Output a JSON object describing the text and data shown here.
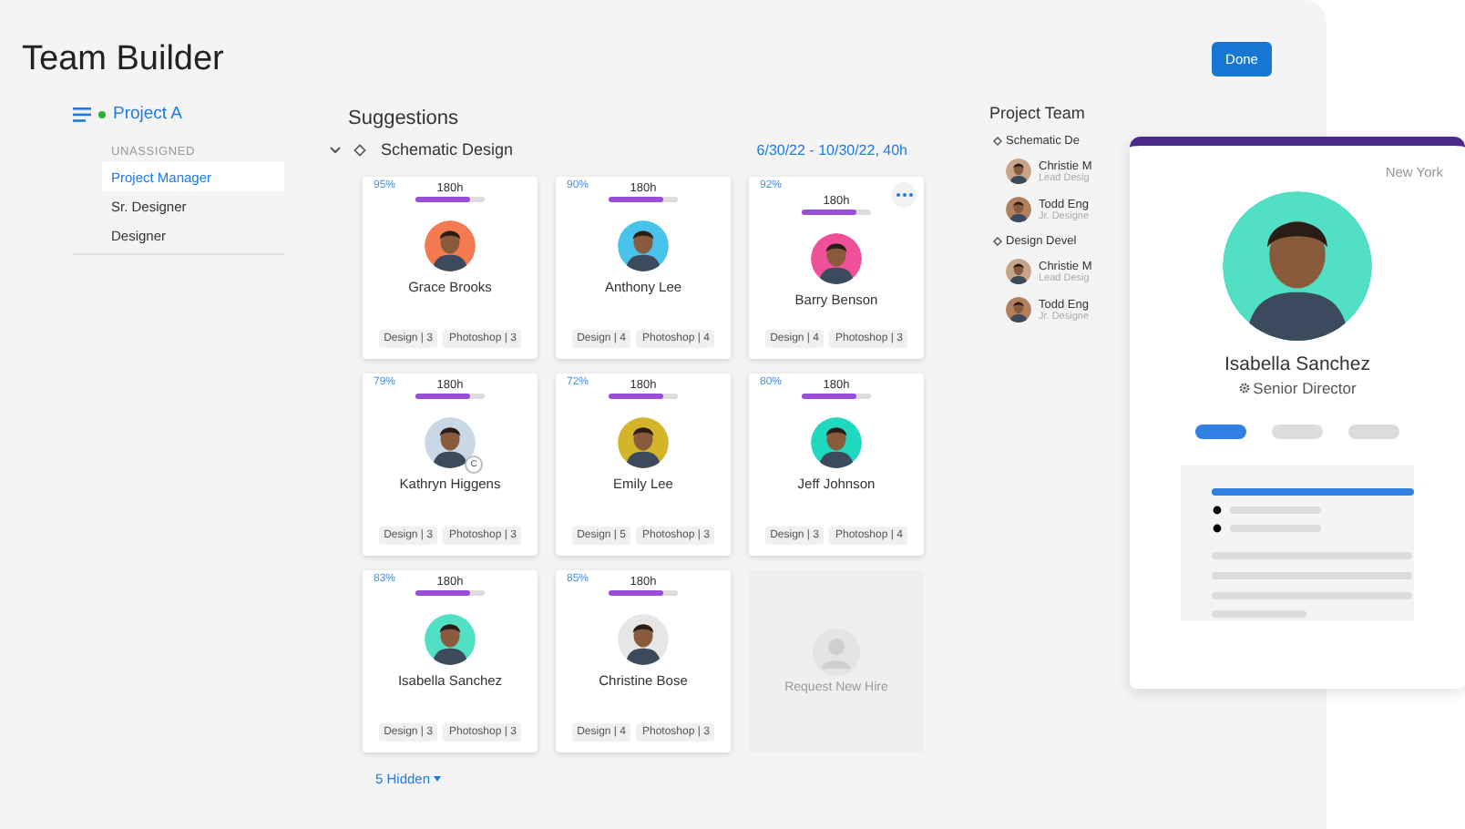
{
  "header": {
    "title": "Team Builder",
    "done_button": "Done"
  },
  "sidebar": {
    "project": "Project A",
    "section_label": "UNASSIGNED",
    "items": [
      {
        "label": "Project Manager",
        "selected": true
      },
      {
        "label": "Sr. Designer",
        "selected": false
      },
      {
        "label": "Designer",
        "selected": false
      }
    ]
  },
  "suggestions": {
    "title": "Suggestions",
    "phase": {
      "name": "Schematic Design",
      "expanded": true,
      "dates": "6/30/22 - 10/30/22, 40h"
    },
    "cards": [
      {
        "kind": "person",
        "match": "95%",
        "hours": "180h",
        "level": 0.78,
        "name": "Grace Brooks",
        "color": "#f47a50",
        "skills": [
          "Design | 3",
          "Photoshop | 3"
        ],
        "has_menu": false
      },
      {
        "kind": "person",
        "match": "90%",
        "hours": "180h",
        "level": 0.78,
        "name": "Anthony Lee",
        "color": "#49c3ec",
        "skills": [
          "Design | 4",
          "Photoshop | 4"
        ],
        "has_menu": false
      },
      {
        "kind": "person",
        "match": "92%",
        "hours": "180h",
        "level": 0.78,
        "name": "Barry Benson",
        "color": "#f0509a",
        "skills": [
          "Design | 4",
          "Photoshop | 3"
        ],
        "has_menu": true
      },
      {
        "kind": "person",
        "match": "79%",
        "hours": "180h",
        "level": 0.78,
        "name": "Kathryn Higgens",
        "color": "#c9d8e4",
        "skills": [
          "Design | 3",
          "Photoshop | 3"
        ],
        "has_menu": false,
        "badge": "C"
      },
      {
        "kind": "person",
        "match": "72%",
        "hours": "180h",
        "level": 0.78,
        "name": "Emily Lee",
        "color": "#d4b52a",
        "skills": [
          "Design | 5",
          "Photoshop | 3"
        ],
        "has_menu": false
      },
      {
        "kind": "person",
        "match": "80%",
        "hours": "180h",
        "level": 0.78,
        "name": "Jeff Johnson",
        "color": "#1fd8c0",
        "skills": [
          "Design | 3",
          "Photoshop | 4"
        ],
        "has_menu": false
      },
      {
        "kind": "person",
        "match": "83%",
        "hours": "180h",
        "level": 0.78,
        "name": "Isabella Sanchez",
        "color": "#52e0c4",
        "skills": [
          "Design | 3",
          "Photoshop | 3"
        ],
        "has_menu": false
      },
      {
        "kind": "person",
        "match": "85%",
        "hours": "180h",
        "level": 0.78,
        "name": "Christine Bose",
        "color": "#e6e6e6",
        "skills": [
          "Design | 4",
          "Photoshop | 3"
        ],
        "has_menu": false
      },
      {
        "kind": "request",
        "label": "Request New Hire"
      }
    ],
    "hidden_toggle": "5 Hidden"
  },
  "team": {
    "title": "Project Team",
    "groups": [
      {
        "name": "Schematic De",
        "members": [
          {
            "name": "Christie M",
            "role": "Lead Desig",
            "color": "#c8a58a"
          },
          {
            "name": "Todd Eng",
            "role": "Jr. Designe",
            "color": "#b08060"
          }
        ]
      },
      {
        "name": "Design Devel",
        "members": [
          {
            "name": "Christie M",
            "role": "Lead Desig",
            "color": "#c8a58a"
          },
          {
            "name": "Todd Eng",
            "role": "Jr. Designe",
            "color": "#b08060"
          }
        ]
      }
    ]
  },
  "profile": {
    "location": "New York",
    "name": "Isabella Sanchez",
    "title": "Senior Director",
    "color": "#52e0c4"
  }
}
